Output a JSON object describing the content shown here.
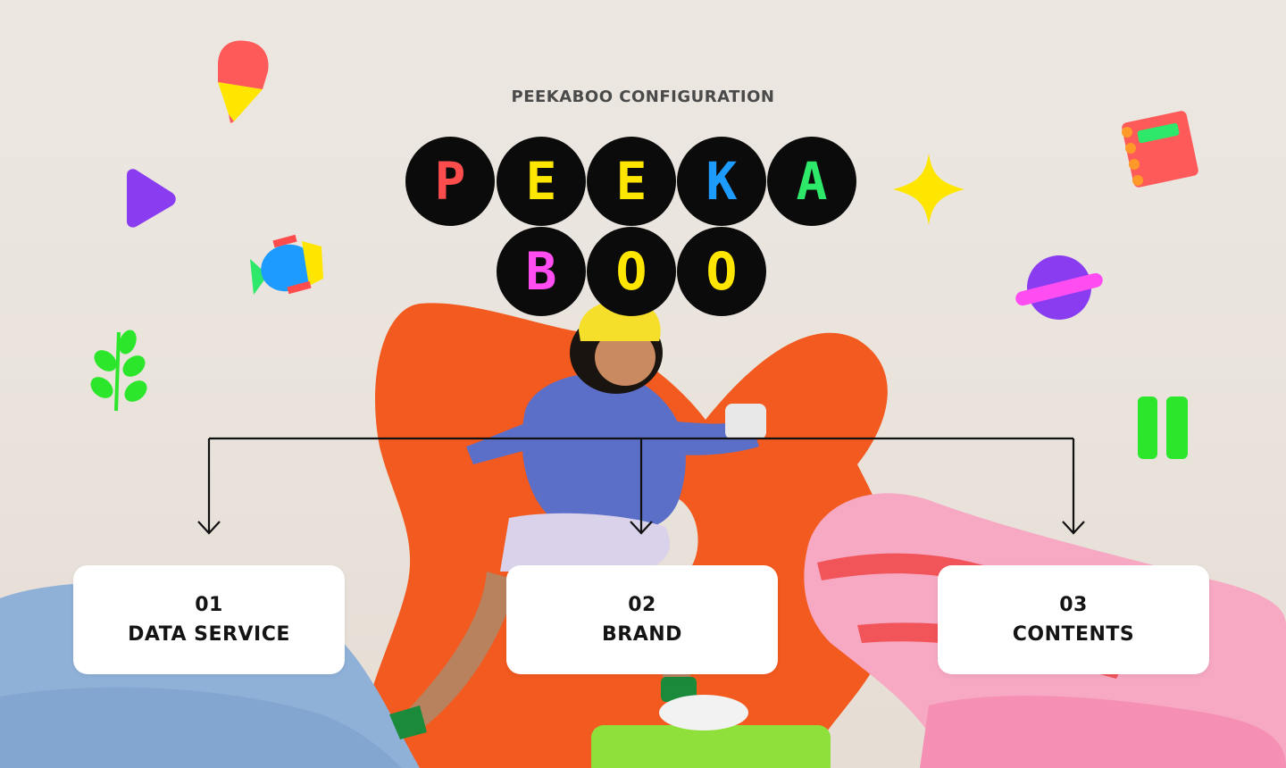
{
  "header": {
    "text": "PEEKABOO CONFIGURATION",
    "color": "#4a4a4a"
  },
  "logo": {
    "row1": [
      {
        "letter": "P",
        "color": "#ff4d4d"
      },
      {
        "letter": "E",
        "color": "#ffe600"
      },
      {
        "letter": "E",
        "color": "#ffe600"
      },
      {
        "letter": "K",
        "color": "#1e9bff"
      },
      {
        "letter": "A",
        "color": "#2ee86a"
      }
    ],
    "row2": [
      {
        "letter": "B",
        "color": "#ff4df2"
      },
      {
        "letter": "O",
        "color": "#ffe600"
      },
      {
        "letter": "O",
        "color": "#ffe600"
      }
    ]
  },
  "cards": [
    {
      "number": "01",
      "label": "DATA SERVICE"
    },
    {
      "number": "02",
      "label": "BRAND"
    },
    {
      "number": "03",
      "label": "CONTENTS"
    }
  ],
  "icons": [
    "ice-cream-icon",
    "play-icon",
    "fish-icon",
    "leaf-icon",
    "sparkle-icon",
    "notebook-icon",
    "planet-icon",
    "pause-icon"
  ],
  "colors": {
    "connector": "#111111",
    "orange_chair": "#f25a1f",
    "blue_cushion": "#8fb1d8",
    "pink_cushion": "#f7a8c2",
    "green_stool": "#8fe03a"
  }
}
